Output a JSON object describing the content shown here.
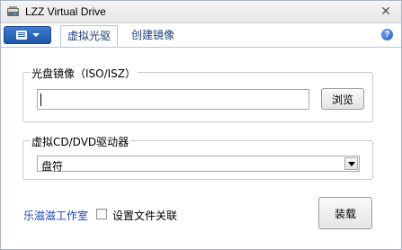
{
  "window": {
    "title": "LZZ Virtual Drive",
    "close_glyph": "✕"
  },
  "toolbar": {
    "tabs": [
      {
        "label": "虚拟光驱",
        "active": true
      },
      {
        "label": "创建镜像",
        "active": false
      }
    ],
    "help_glyph": "?"
  },
  "image_group": {
    "legend": "光盘镜像（ISO/ISZ）",
    "path_value": "",
    "browse_label": "浏览"
  },
  "drive_group": {
    "legend": "虚拟CD/DVD驱动器",
    "selected": "盘符"
  },
  "footer": {
    "studio_link": "乐滋滋工作室",
    "associate_label": "设置文件关联",
    "associate_checked": false,
    "load_label": "装载"
  },
  "colors": {
    "accent": "#1e56a8",
    "tab_text": "#1c3f7a",
    "link": "#1b3fb5"
  },
  "icons": {
    "app": "virtual-drive-app-icon",
    "menu": "menu-icon",
    "help": "help-icon",
    "close": "close-icon",
    "dropdown": "chevron-down-icon"
  }
}
